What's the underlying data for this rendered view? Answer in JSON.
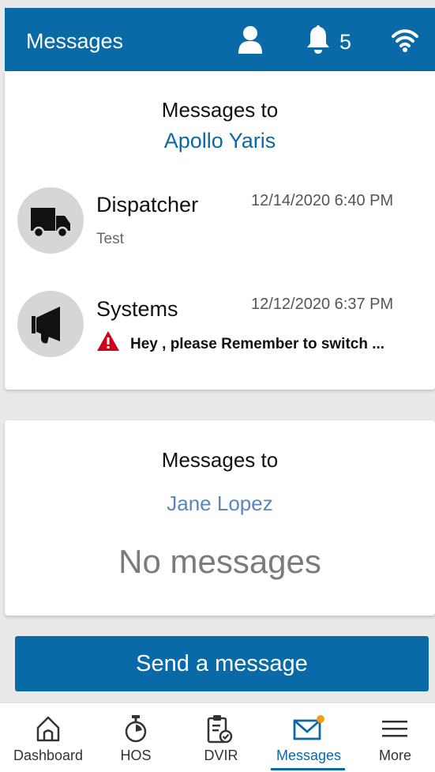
{
  "header": {
    "title": "Messages",
    "notification_count": "5",
    "icons": [
      "user-icon",
      "bell-icon",
      "wifi-icon"
    ]
  },
  "section1": {
    "label": "Messages to",
    "recipient": "Apollo Yaris",
    "messages": [
      {
        "sender": "Dispatcher",
        "datetime": "12/14/2020 6:40 PM",
        "preview": "Test",
        "icon": "truck-icon"
      },
      {
        "sender": "Systems",
        "datetime": "12/12/2020 6:37 PM",
        "preview": "Hey , please Remember to switch ...",
        "icon": "megaphone-icon",
        "alert_icon": "warning-icon"
      }
    ]
  },
  "section2": {
    "label": "Messages to",
    "recipient": "Jane Lopez",
    "empty_text": "No messages"
  },
  "send_button": "Send a message",
  "nav": {
    "items": [
      {
        "label": "Dashboard",
        "icon": "home-icon"
      },
      {
        "label": "HOS",
        "icon": "stopwatch-icon"
      },
      {
        "label": "DVIR",
        "icon": "clipboard-check-icon"
      },
      {
        "label": "Messages",
        "icon": "envelope-icon",
        "active": true
      },
      {
        "label": "More",
        "icon": "menu-icon"
      }
    ]
  },
  "colors": {
    "primary": "#0a6aa8",
    "badge_dot": "#f39c12",
    "warning": "#d0021b"
  }
}
